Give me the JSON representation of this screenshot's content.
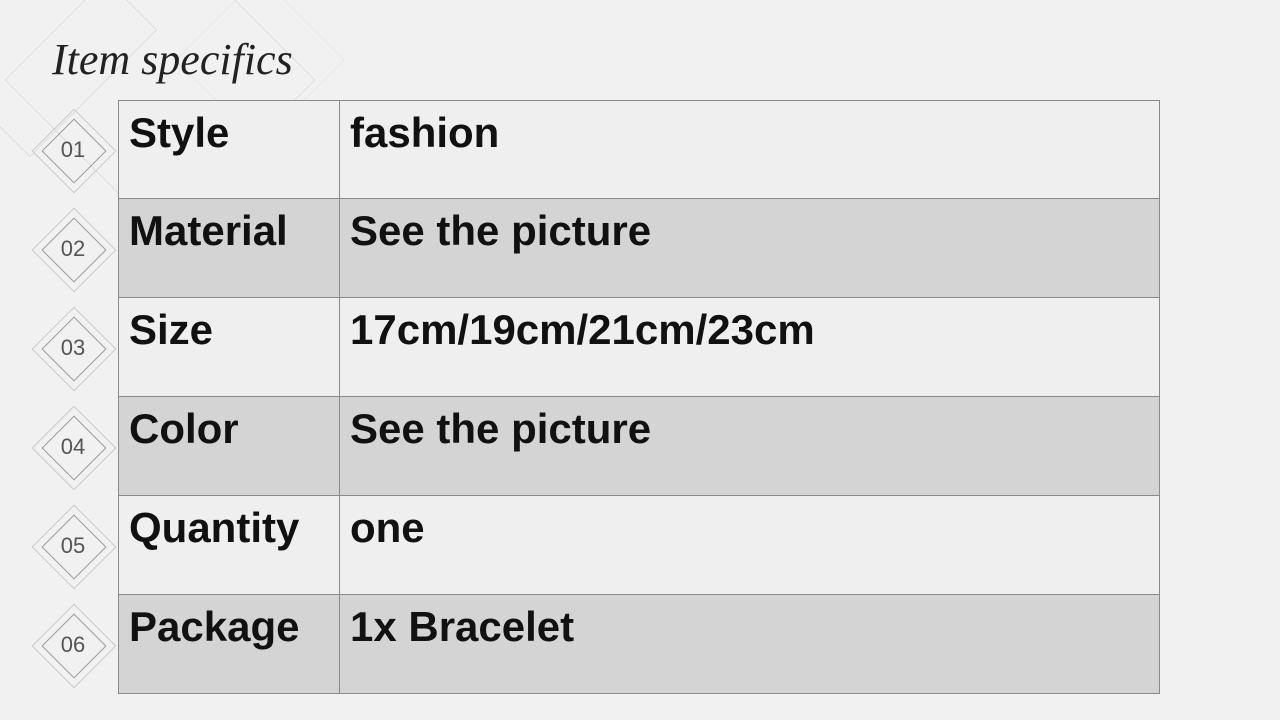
{
  "title": "Item specifics",
  "rows": [
    {
      "num": "01",
      "key": "Style",
      "val": "fashion"
    },
    {
      "num": "02",
      "key": "Material",
      "val": "See the picture"
    },
    {
      "num": "03",
      "key": "Size",
      "val": "17cm/19cm/21cm/23cm"
    },
    {
      "num": "04",
      "key": "Color",
      "val": "See the picture"
    },
    {
      "num": "05",
      "key": "Quantity",
      "val": "one"
    },
    {
      "num": "06",
      "key": "Package",
      "val": "1x Bracelet"
    }
  ]
}
